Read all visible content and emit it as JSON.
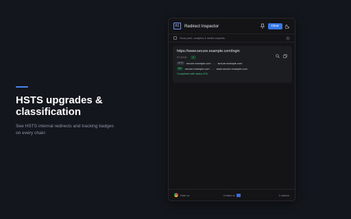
{
  "promo": {
    "title": "HSTS upgrades & classification",
    "description": "See HSTS internal redirects and tracking badges on every chain"
  },
  "app": {
    "title": "Redirect Inspector",
    "clear_label": "Clear",
    "logo_text": "RI"
  },
  "options": {
    "label": "Show pixel, analytics & media requests",
    "info": "i"
  },
  "card": {
    "url": "https://www.secure.example.com/login",
    "time": "07:15:01",
    "count": "2",
    "hops": [
      {
        "badge": "HSTS",
        "from": "secure.example.com",
        "to": "secure.example.com"
      },
      {
        "badge": "301",
        "from": "secure.example.com",
        "to": "www.secure.example.com"
      }
    ],
    "status": "Completed with status 200"
  },
  "footer": {
    "rate": "Rate us",
    "crafted": "Crafted at",
    "visitors": "3 visitors"
  },
  "colors": {
    "accent": "#3578e6",
    "success": "#4fca84",
    "background": "#13161c",
    "panel": "#141416"
  }
}
